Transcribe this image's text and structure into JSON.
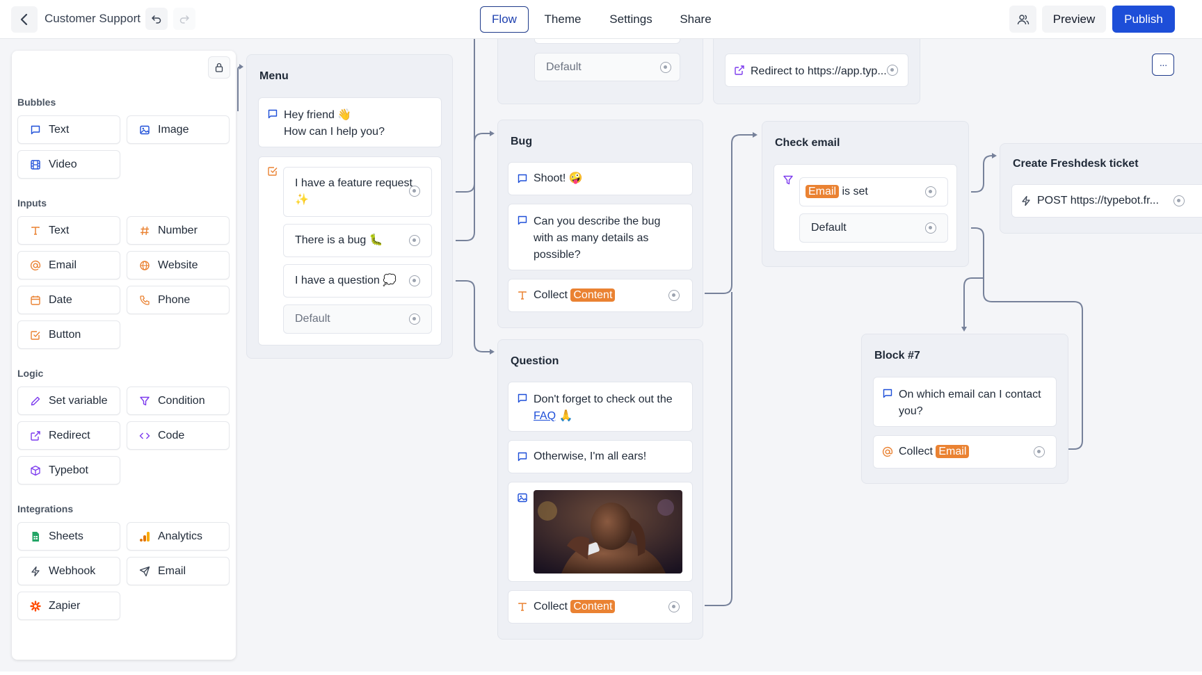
{
  "header": {
    "title": "Customer Support",
    "tabs": [
      "Flow",
      "Theme",
      "Settings",
      "Share"
    ],
    "preview_label": "Preview",
    "publish_label": "Publish"
  },
  "sidebar": {
    "sections": [
      {
        "title": "Bubbles",
        "items": [
          "Text",
          "Image",
          "Video"
        ]
      },
      {
        "title": "Inputs",
        "items": [
          "Text",
          "Number",
          "Email",
          "Website",
          "Date",
          "Phone",
          "Button"
        ]
      },
      {
        "title": "Logic",
        "items": [
          "Set variable",
          "Condition",
          "Redirect",
          "Code",
          "Typebot"
        ]
      },
      {
        "title": "Integrations",
        "items": [
          "Sheets",
          "Analytics",
          "Webhook",
          "Email",
          "Zapier"
        ]
      }
    ]
  },
  "blocks": {
    "top_partial": {
      "default_label": "Default"
    },
    "redirect_partial": {
      "text": "Redirect to https://app.typ..."
    },
    "menu": {
      "title": "Menu",
      "greeting_line1": "Hey friend 👋",
      "greeting_line2": "How can I help you?",
      "choices": [
        "I have a feature request ✨",
        "There is a bug 🐛",
        "I have a question 💭"
      ],
      "default_label": "Default"
    },
    "bug": {
      "title": "Bug",
      "msg1": "Shoot! 🤪",
      "msg2_line1": "Can you describe the bug",
      "msg2_line2": "with as many details as",
      "msg2_line3": "possible?",
      "collect_label": "Collect",
      "collect_var": "Content"
    },
    "question": {
      "title": "Question",
      "msg1_line1": "Don't forget to check out the",
      "msg1_link": "FAQ",
      "msg1_emoji": "🙏",
      "msg2": "Otherwise, I'm all ears!",
      "collect_label": "Collect",
      "collect_var": "Content"
    },
    "check_email": {
      "title": "Check email",
      "condition_var": "Email",
      "condition_text": "is set",
      "default_label": "Default"
    },
    "freshdesk": {
      "title": "Create Freshdesk ticket",
      "request": "POST https://typebot.fr..."
    },
    "block7": {
      "title": "Block #7",
      "msg_line1": "On which email can I contact",
      "msg_line2": "you?",
      "collect_label": "Collect",
      "collect_var": "Email"
    }
  },
  "colors": {
    "accent": "#1d4ed8",
    "variable_tag": "#ea8232",
    "bubble_icon": "#1d4ed8",
    "input_icon": "#ea8232",
    "logic_icon": "#7c3aed"
  }
}
